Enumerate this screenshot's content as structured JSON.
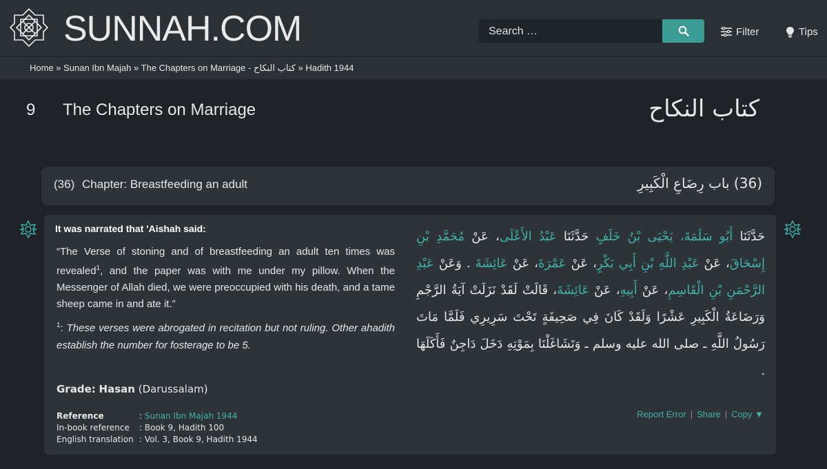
{
  "header": {
    "logo_text": "SUNNAH.COM",
    "search_placeholder": "Search …",
    "filter_label": "Filter",
    "tips_label": "Tips"
  },
  "breadcrumb": "Home » Sunan Ibn Majah » The Chapters on Marriage - كتاب النكاح » Hadith 1944",
  "book": {
    "number": "9",
    "title": "The Chapters on Marriage",
    "arabic_title": "كتاب النكاح"
  },
  "chapter": {
    "number": "(36)",
    "title": "Chapter: Breastfeeding an adult",
    "arabic_number": "(36)",
    "arabic_title": "باب رِضَاعِ الْكَبِيرِ"
  },
  "hadith": {
    "narrator": "It was narrated that 'Aishah said:",
    "text_part1": "“The Verse of stoning and of breastfeeding an adult ten times was revealed",
    "footnote_marker": "1",
    "text_part2": ", and the paper was with me under my pillow. When the Messenger of Allah died, we were preoccupied with his death, and a tame sheep came in and ate it.”",
    "footnote_label": "1",
    "footnote_text": "These verses were abrogated in recitation but not ruling. Other ahadith establish the number for fosterage to be 5.",
    "arabic_a1": "حَدَّثَنَا",
    "arabic_h1": "أَبُو سَلَمَةَ، يَحْيَى بْنُ خَلَفٍ",
    "arabic_a2": "حَدَّثَنَا",
    "arabic_h2": "عَبْدُ الأَعْلَى",
    "arabic_a3": "، عَنْ",
    "arabic_h3": "مُحَمَّدِ بْنِ إِسْحَاقَ",
    "arabic_a4": "، عَنْ",
    "arabic_h4": "عَبْدِ اللَّهِ بْنِ أَبِي بَكْرٍ",
    "arabic_a5": "، عَنْ",
    "arabic_h5": "عَمْرَةَ",
    "arabic_a6": "، عَنْ",
    "arabic_h6": "عَائِشَةَ",
    "arabic_a7": ". وَعَنْ",
    "arabic_h7": "عَبْدِ الرَّحْمَنِ بْنِ الْقَاسِمِ",
    "arabic_a8": "، عَنْ",
    "arabic_h8": "أَبِيهِ",
    "arabic_a9": "، عَنْ",
    "arabic_h9": "عَائِشَةَ",
    "arabic_a10": "، قَالَتْ لَقَدْ نَزَلَتْ آيَةُ الرَّجْمِ وَرَضَاعَةُ الْكَبِيرِ عَشْرًا وَلَقَدْ كَانَ فِي صَحِيفَةٍ تَحْتَ سَرِيرِي فَلَمَّا مَاتَ رَسُولُ اللَّهِ ـ صلى الله عليه وسلم ـ وَتَشَاغَلْنَا بِمَوْتِهِ دَخَلَ دَاجِنٌ فَأَكَلَهَا ‏.‏",
    "grade_label": "Grade",
    "grade_sep": ":",
    "grade_value": "Hasan",
    "grade_source": "(Darussalam)",
    "reference_label": "Reference",
    "reference_value": "Sunan Ibn Majah 1944",
    "inbook_label": "In-book reference",
    "inbook_value": "Book 9, Hadith 100",
    "english_label": "English translation",
    "english_value": "Vol. 3, Book 9, Hadith 1944",
    "colon": ":"
  },
  "actions": {
    "report": "Report Error",
    "share": "Share",
    "copy": "Copy ▼",
    "separator": "|"
  },
  "colors": {
    "accent": "#3b9b95",
    "link": "#3fb2aa",
    "background": "#1f2327",
    "panel": "#2d3337"
  }
}
